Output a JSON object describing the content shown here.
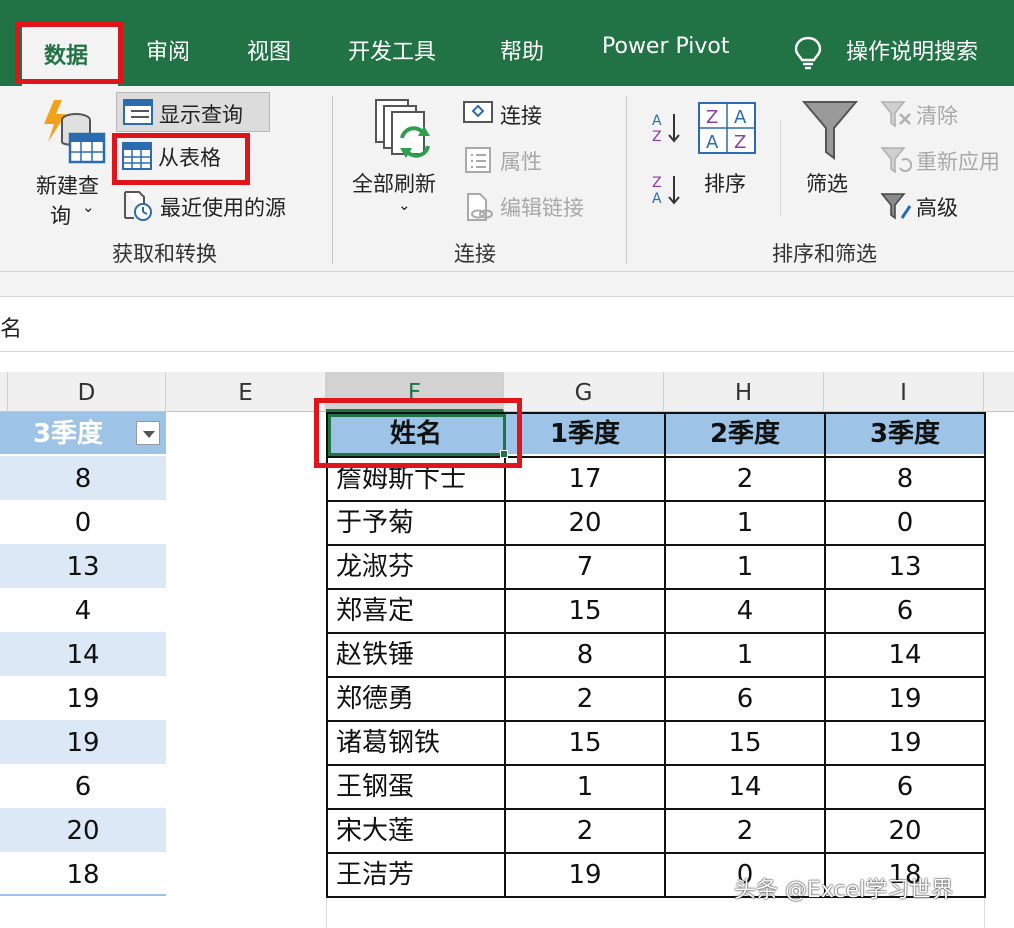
{
  "tabs": {
    "data": "数据",
    "review": "审阅",
    "view": "视图",
    "developer": "开发工具",
    "help": "帮助",
    "power_pivot": "Power Pivot",
    "tell_me": "操作说明搜索"
  },
  "ribbon": {
    "get_transform": {
      "new_query_line1": "新建查",
      "new_query_line2": "询",
      "show_queries": "显示查询",
      "from_table": "从表格",
      "recent_sources": "最近使用的源",
      "group_label": "获取和转换"
    },
    "connections": {
      "refresh_all": "全部刷新",
      "connections": "连接",
      "properties": "属性",
      "edit_links": "编辑链接",
      "group_label": "连接"
    },
    "sort_filter": {
      "sort": "排序",
      "filter": "筛选",
      "clear": "清除",
      "reapply": "重新应用",
      "advanced": "高级",
      "group_label": "排序和筛选"
    }
  },
  "formula_bar": {
    "text": "名"
  },
  "columns": [
    "D",
    "E",
    "F",
    "G",
    "H",
    "I"
  ],
  "left_table": {
    "header": "3季度",
    "values": [
      "8",
      "0",
      "13",
      "4",
      "14",
      "19",
      "19",
      "6",
      "20",
      "18"
    ]
  },
  "right_table": {
    "headers": [
      "姓名",
      "1季度",
      "2季度",
      "3季度"
    ],
    "rows": [
      [
        "詹姆斯卞士",
        "17",
        "2",
        "8"
      ],
      [
        "于予菊",
        "20",
        "1",
        "0"
      ],
      [
        "龙淑芬",
        "7",
        "1",
        "13"
      ],
      [
        "郑喜定",
        "15",
        "4",
        "6"
      ],
      [
        "赵铁锤",
        "8",
        "1",
        "14"
      ],
      [
        "郑德勇",
        "2",
        "6",
        "19"
      ],
      [
        "诸葛钢铁",
        "15",
        "15",
        "19"
      ],
      [
        "王钢蛋",
        "1",
        "14",
        "6"
      ],
      [
        "宋大莲",
        "2",
        "2",
        "20"
      ],
      [
        "王洁芳",
        "19",
        "0",
        "18"
      ]
    ]
  },
  "watermark": "头条 @Excel学习世界",
  "colors": {
    "excel_green": "#217346",
    "highlight_red": "#e0141b",
    "table_header_blue": "#9dc3e6",
    "band_blue": "#dde8f7"
  }
}
